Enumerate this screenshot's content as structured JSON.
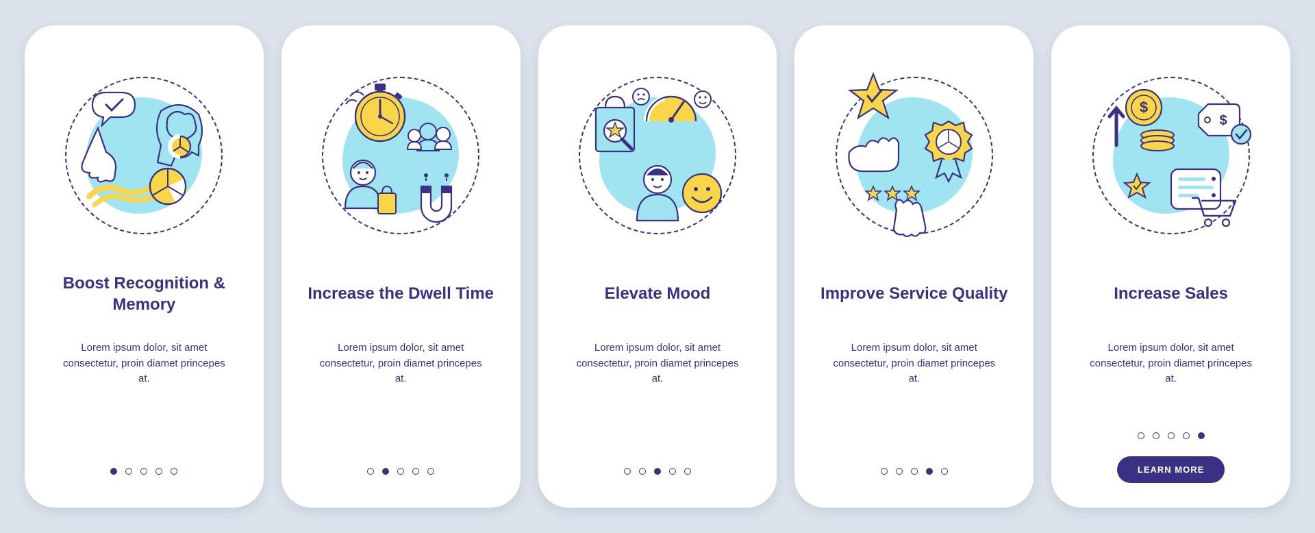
{
  "colors": {
    "indigo": "#393185",
    "yellow": "#f9d648",
    "sky": "#9fe4f0"
  },
  "body_text": "Lorem ipsum dolor, sit amet consectetur, proin diamet princepes at.",
  "cta_label": "LEARN MORE",
  "slide_count": 5,
  "slides": [
    {
      "title": "Boost Recognition & Memory",
      "active_index": 0,
      "icon": "memory"
    },
    {
      "title": "Increase the Dwell Time",
      "active_index": 1,
      "icon": "dwell"
    },
    {
      "title": "Elevate Mood",
      "active_index": 2,
      "icon": "mood"
    },
    {
      "title": "Improve Service Quality",
      "active_index": 3,
      "icon": "quality"
    },
    {
      "title": "Increase Sales",
      "active_index": 4,
      "icon": "sales"
    }
  ]
}
